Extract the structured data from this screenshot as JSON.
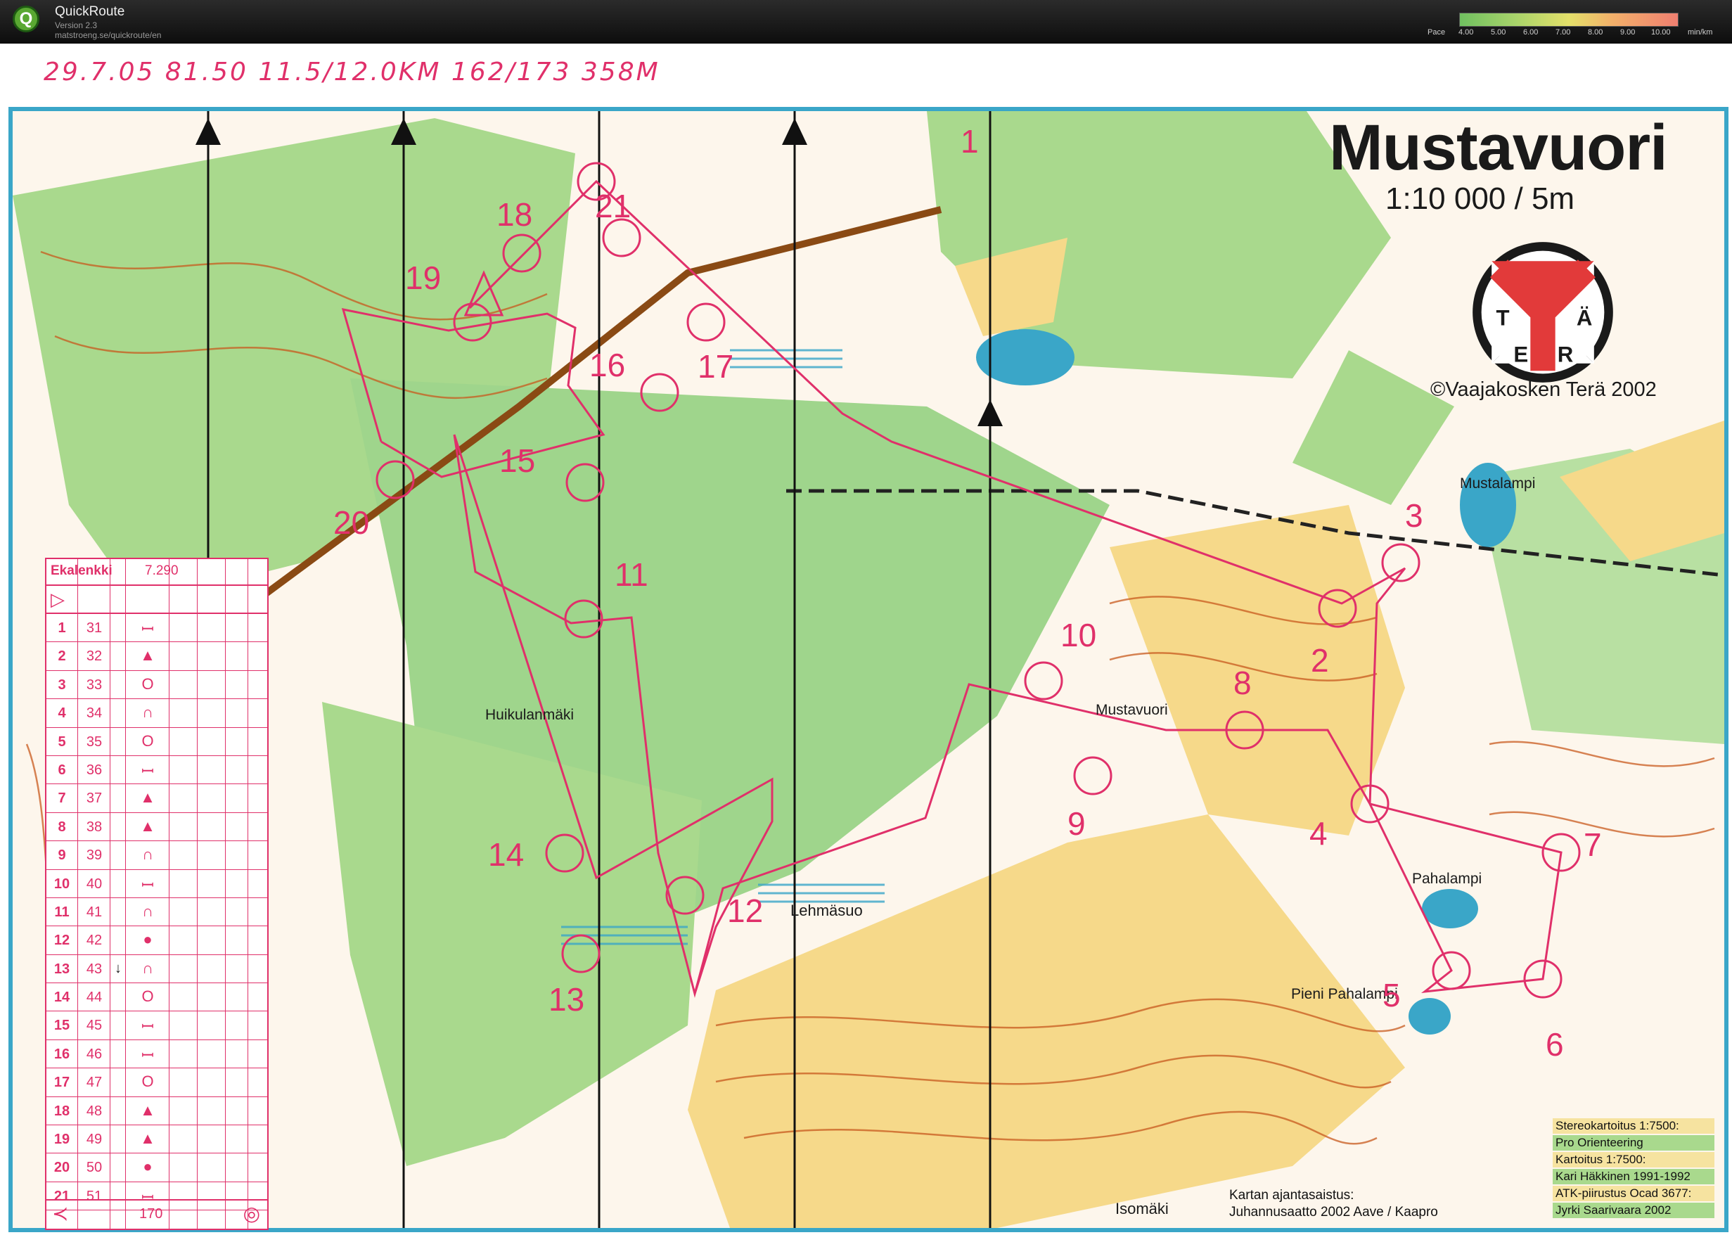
{
  "app": {
    "name": "QuickRoute",
    "version": "Version 2.3",
    "url": "matstroeng.se/quickroute/en",
    "logo_letter": "Q"
  },
  "pace_legend": {
    "label": "Pace",
    "ticks": [
      "4.00",
      "5.00",
      "6.00",
      "7.00",
      "8.00",
      "9.00",
      "10.00"
    ],
    "unit": "min/km"
  },
  "handwritten_note": "29.7.05   81.50   11.5/12.0KM   162/173   358M",
  "map": {
    "title": "Mustavuori",
    "scale": "1:10 000 / 5m",
    "copyright": "©Vaajakosken Terä 2002",
    "club_logo_letters": [
      "T",
      "E",
      "R",
      "Ä"
    ],
    "places": {
      "mustalampi": "Mustalampi",
      "huikulanmaki": "Huikulanmäki",
      "mustavuori": "Mustavuori",
      "pahalampi": "Pahalampi",
      "lehmasuo": "Lehmäsuo",
      "pieni_pahalampi": "Pieni Pahalampi",
      "isomaki": "Isomäki"
    },
    "credits": [
      "Stereokartoitus 1:7500:",
      "Pro Orienteering",
      "Kartoitus 1:7500:",
      "Kari Häkkinen 1991-1992",
      "ATK-piirustus Ocad 3677:",
      "Jyrki Saarivaara 2002"
    ],
    "update_label": "Kartan ajantasaistus:",
    "update_text": "Juhannusaatto 2002  Aave /  Kaapro",
    "control_numbers": [
      "1",
      "2",
      "3",
      "4",
      "5",
      "6",
      "7",
      "8",
      "9",
      "10",
      "11",
      "12",
      "13",
      "14",
      "15",
      "16",
      "17",
      "18",
      "19",
      "20",
      "21"
    ]
  },
  "description_sheet": {
    "course_name": "Ekalenkki",
    "course_length": "7.290",
    "start_symbol": "▷",
    "finish_distance": "170",
    "rows": [
      {
        "no": "1",
        "code": "31",
        "mark": "",
        "feat": "ꟷ"
      },
      {
        "no": "2",
        "code": "32",
        "mark": "",
        "feat": "▲"
      },
      {
        "no": "3",
        "code": "33",
        "mark": "",
        "feat": "O"
      },
      {
        "no": "4",
        "code": "34",
        "mark": "",
        "feat": "∩"
      },
      {
        "no": "5",
        "code": "35",
        "mark": "",
        "feat": "O"
      },
      {
        "no": "6",
        "code": "36",
        "mark": "",
        "feat": "ꟷ"
      },
      {
        "no": "7",
        "code": "37",
        "mark": "",
        "feat": "▲"
      },
      {
        "no": "8",
        "code": "38",
        "mark": "",
        "feat": "▲"
      },
      {
        "no": "9",
        "code": "39",
        "mark": "",
        "feat": "∩"
      },
      {
        "no": "10",
        "code": "40",
        "mark": "",
        "feat": "ꟷ"
      },
      {
        "no": "11",
        "code": "41",
        "mark": "",
        "feat": "∩"
      },
      {
        "no": "12",
        "code": "42",
        "mark": "",
        "feat": "●"
      },
      {
        "no": "13",
        "code": "43",
        "mark": "↓",
        "feat": "∩"
      },
      {
        "no": "14",
        "code": "44",
        "mark": "",
        "feat": "O"
      },
      {
        "no": "15",
        "code": "45",
        "mark": "",
        "feat": "ꟷ"
      },
      {
        "no": "16",
        "code": "46",
        "mark": "",
        "feat": "ꟷ"
      },
      {
        "no": "17",
        "code": "47",
        "mark": "",
        "feat": "O"
      },
      {
        "no": "18",
        "code": "48",
        "mark": "",
        "feat": "▲"
      },
      {
        "no": "19",
        "code": "49",
        "mark": "",
        "feat": "▲"
      },
      {
        "no": "20",
        "code": "50",
        "mark": "",
        "feat": "●"
      },
      {
        "no": "21",
        "code": "51",
        "mark": "",
        "feat": "ꟷ"
      }
    ]
  },
  "colors": {
    "course": "#e0306a",
    "forest_green": "#9fd58c",
    "open_yellow": "#f6d98a",
    "contour_brown": "#c85a1e",
    "water_blue": "#3aa6c8",
    "frame_blue": "#3aa6c8"
  }
}
